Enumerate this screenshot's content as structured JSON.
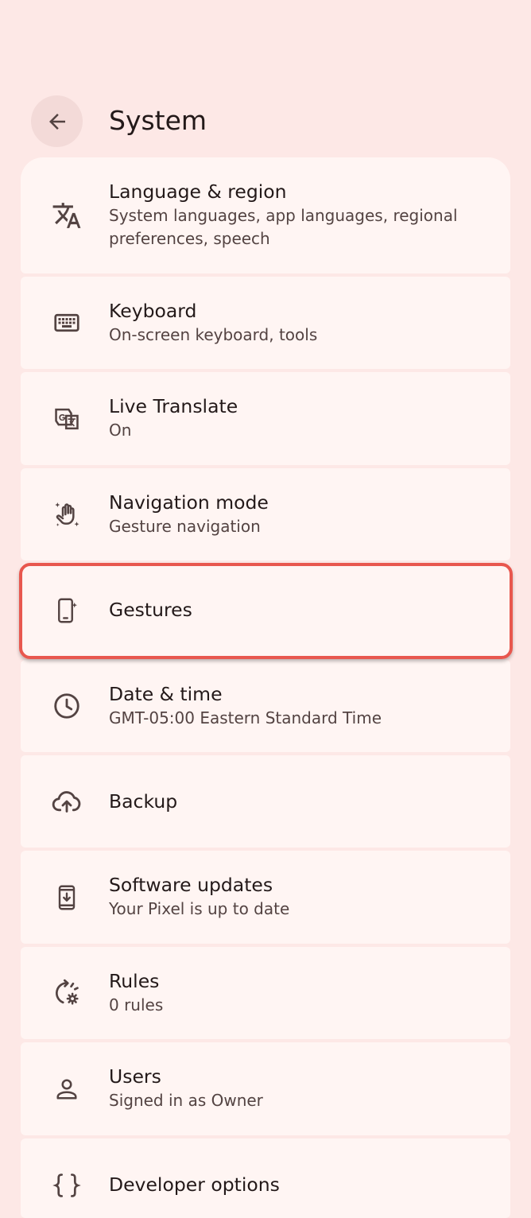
{
  "header": {
    "back_icon": "arrow-back-icon",
    "title": "System"
  },
  "items": [
    {
      "title": "Language & region",
      "summary": "System languages, app languages, regional preferences, speech",
      "icon": "translate-icon"
    },
    {
      "title": "Keyboard",
      "summary": "On-screen keyboard, tools",
      "icon": "keyboard-icon"
    },
    {
      "title": "Live Translate",
      "summary": "On",
      "icon": "live-translate-icon"
    },
    {
      "title": "Navigation mode",
      "summary": "Gesture navigation",
      "icon": "gesture-hand-icon"
    },
    {
      "title": "Gestures",
      "summary": "",
      "icon": "phone-gesture-icon",
      "highlighted": true
    },
    {
      "title": "Date & time",
      "summary": "GMT-05:00 Eastern Standard Time",
      "icon": "clock-icon"
    },
    {
      "title": "Backup",
      "summary": "",
      "icon": "cloud-upload-icon"
    },
    {
      "title": "Software updates",
      "summary": "Your Pixel is up to date",
      "icon": "system-update-icon"
    },
    {
      "title": "Rules",
      "summary": "0 rules",
      "icon": "rules-icon"
    },
    {
      "title": "Users",
      "summary": "Signed in as Owner",
      "icon": "person-icon"
    },
    {
      "title": "Developer options",
      "summary": "",
      "icon": "code-braces-icon"
    }
  ],
  "colors": {
    "background": "#FDE8E6",
    "card": "#FFF5F3",
    "text_primary": "#231919",
    "text_secondary": "#534342",
    "highlight_border": "#E8574E"
  }
}
